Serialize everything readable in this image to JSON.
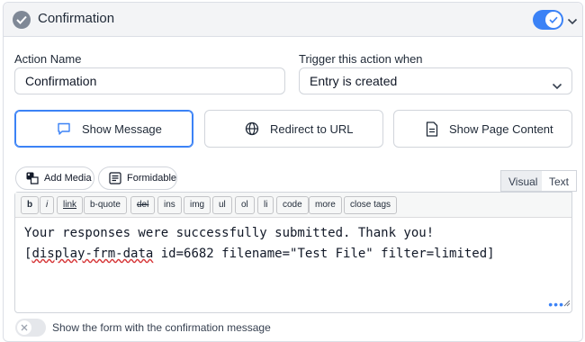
{
  "header": {
    "title": "Confirmation",
    "enabled": true
  },
  "form": {
    "action_name_label": "Action Name",
    "action_name_value": "Confirmation",
    "trigger_label": "Trigger this action when",
    "trigger_value": "Entry is created"
  },
  "choices": [
    {
      "label": "Show Message",
      "icon": "message-icon",
      "selected": true
    },
    {
      "label": "Redirect to URL",
      "icon": "globe-icon",
      "selected": false
    },
    {
      "label": "Show Page Content",
      "icon": "document-icon",
      "selected": false
    }
  ],
  "media_buttons": {
    "add_media": "Add Media",
    "formidable": "Formidable"
  },
  "editor_tabs": {
    "visual": "Visual",
    "text": "Text",
    "active": "Visual"
  },
  "quicktags": [
    "b",
    "i",
    "link",
    "b-quote",
    "del",
    "ins",
    "img",
    "ul",
    "ol",
    "li",
    "code",
    "more",
    "close tags"
  ],
  "editor_content": {
    "line1": "Your responses were successfully submitted. Thank you!",
    "line2_shortcode": "display-frm-data",
    "line2_rest": " id=6682 filename=\"Test File\" filter=limited]",
    "line2_open": "["
  },
  "show_form_toggle": {
    "label": "Show the form with the confirmation message",
    "enabled": false
  },
  "colors": {
    "accent": "#3b82f6",
    "badge": "#7f8896"
  }
}
